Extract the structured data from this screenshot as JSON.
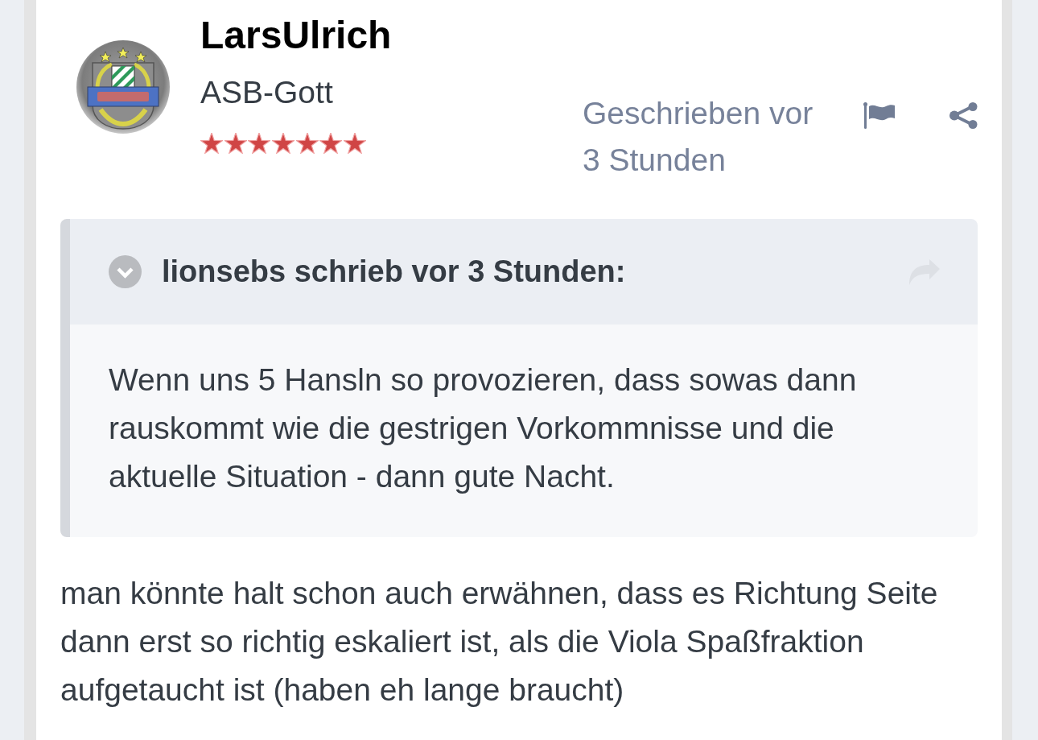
{
  "author": {
    "name": "LarsUlrich",
    "rank": "ASB-Gott",
    "stars": 7
  },
  "post_meta": {
    "timestamp": "Geschrieben vor 3 Stunden"
  },
  "quote": {
    "header": "lionsebs schrieb vor 3 Stunden:",
    "text": "Wenn uns 5 Hansln so provozieren, dass sowas dann rauskommt wie die gestrigen Vorkommnisse und die aktuelle Situation - dann gute Nacht."
  },
  "post_text": "man könnte halt schon auch erwähnen, dass es Richtung Seite dann erst so richtig eskaliert ist, als die Viola Spaßfraktion aufgetaucht ist (haben eh lange braucht)"
}
